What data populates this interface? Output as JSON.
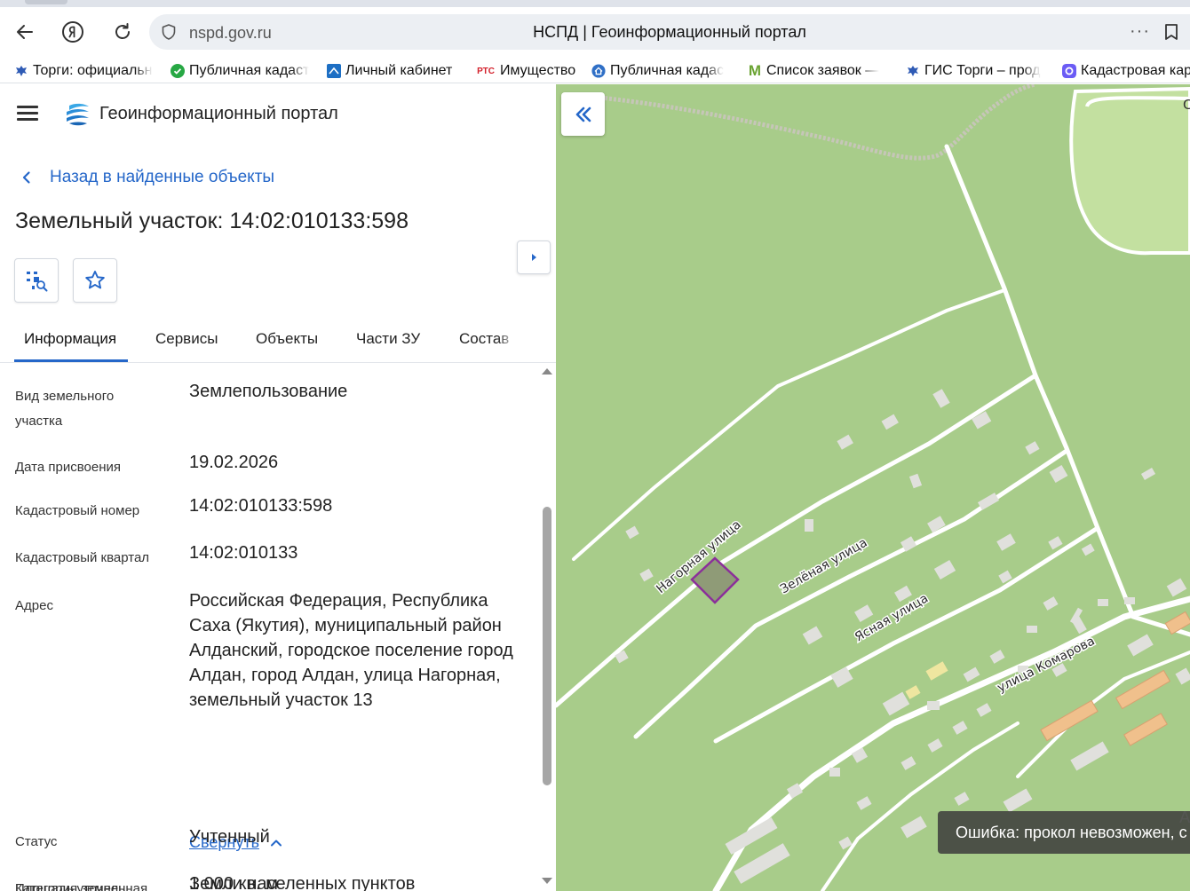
{
  "browser": {
    "url": "nspd.gov.ru",
    "page_title": "НСПД | Геоинформационный портал",
    "more_label": "···",
    "bookmarks": [
      {
        "label": "Торги: официальн",
        "icon": "eagle-icon"
      },
      {
        "label": "Публичная кадаст",
        "icon": "check-circle-icon"
      },
      {
        "label": "Личный кабинет",
        "icon": "rosreestr-icon"
      },
      {
        "label": "Имущество",
        "icon": "rts-icon",
        "icon_text": "РТС"
      },
      {
        "label": "Публичная кадас",
        "icon": "home-icon"
      },
      {
        "label": "Список заявок —",
        "icon": "m-logo-icon",
        "icon_text": "M"
      },
      {
        "label": "ГИС Торги – прод",
        "icon": "eagle-icon"
      },
      {
        "label": "Кадастровая кар",
        "icon": "alice-icon"
      }
    ]
  },
  "header": {
    "portal_name": "Геоинформационный портал"
  },
  "nav": {
    "back_label": "Назад в найденные объекты"
  },
  "object": {
    "title": "Земельный участок: 14:02:010133:598"
  },
  "tabs": [
    {
      "label": "Информация",
      "active": true
    },
    {
      "label": "Сервисы",
      "active": false
    },
    {
      "label": "Объекты",
      "active": false
    },
    {
      "label": "Части ЗУ",
      "active": false
    },
    {
      "label": "Состав",
      "active": false
    }
  ],
  "info": {
    "rows": [
      {
        "label": "Вид земельного участка",
        "value": "Землепользование"
      },
      {
        "label": "Дата присвоения",
        "value": "19.02.2026"
      },
      {
        "label": "Кадастровый номер",
        "value": "14:02:010133:598"
      },
      {
        "label": "Кадастровый квартал",
        "value": "14:02:010133"
      },
      {
        "label": "Адрес",
        "value": "Российская Федерация, Республика Саха (Якутия), муниципальный район Алданский, городское поселение город Алдан, город Алдан, улица Нагорная, земельный участок 13"
      },
      {
        "label": "Площадь уточненная",
        "value": "1 000 кв. м"
      },
      {
        "label": "Статус",
        "value": "Учтенный"
      },
      {
        "label": "Категория земель",
        "value": "Земли населенных пунктов"
      }
    ],
    "collapse_label": "Свернуть"
  },
  "map": {
    "streets": [
      "Нагорная улица",
      "Зелёная улица",
      "Ясная улица",
      "улица Комарова"
    ],
    "parcel_color": "#8b2f9a",
    "corner_label": "С",
    "watermark_letter": "А",
    "toast": "Ошибка: прокол невозможен, с"
  },
  "colors": {
    "accent": "#2567c9",
    "map_green": "#a8cc8a",
    "map_light_green": "#c3e0a0"
  }
}
